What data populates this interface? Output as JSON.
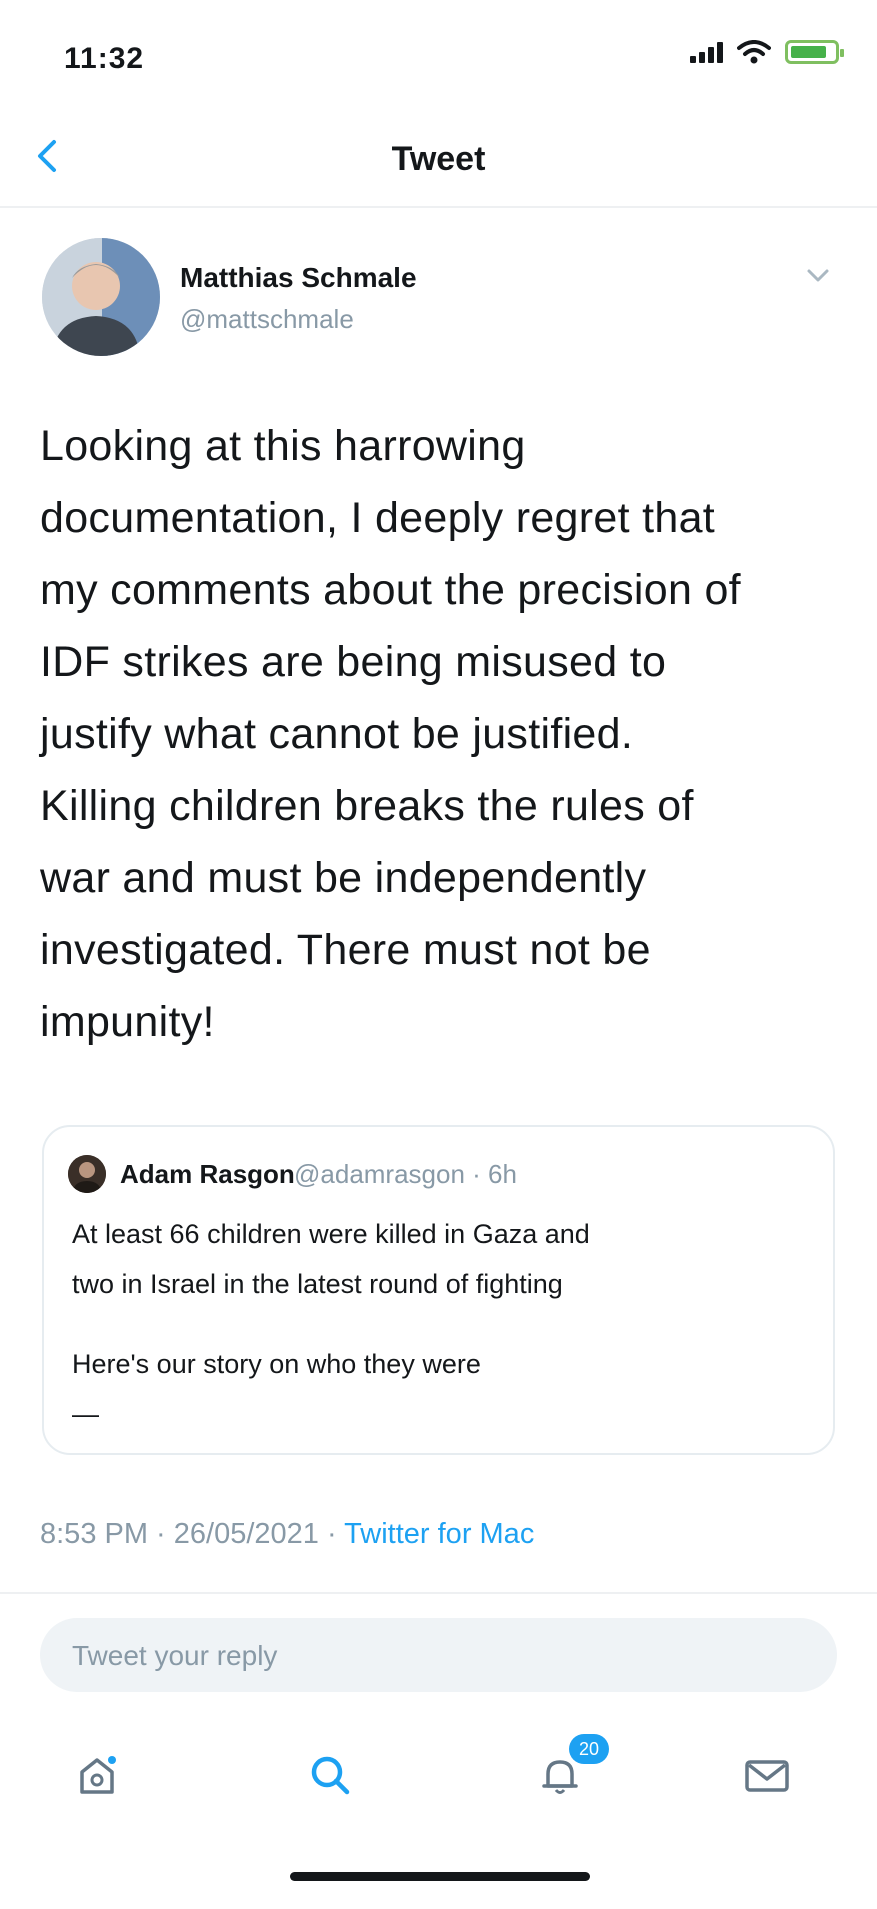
{
  "status_bar": {
    "time": "11:32"
  },
  "nav": {
    "title": "Tweet"
  },
  "tweet": {
    "author_name": "Matthias Schmale",
    "author_handle": "@mattschmale",
    "text_lines": [
      "Looking at this harrowing",
      "documentation, I deeply regret that",
      "my comments about the precision of",
      "IDF strikes are being misused to",
      "justify what cannot be justified.",
      "Killing children breaks the rules of",
      "war and must be independently",
      "investigated. There must not be",
      "impunity!"
    ],
    "quoted": {
      "author_name": "Adam Rasgon",
      "author_handle_time": "@adamrasgon · 6h",
      "line1": "At least 66 children were killed in Gaza and",
      "line2": "two in Israel in the latest round of fighting",
      "line3": "Here's our story on who they were",
      "line4": "—"
    },
    "timestamp": "8:53 PM · 26/05/2021 · ",
    "client": "Twitter for Mac"
  },
  "reply": {
    "placeholder": "Tweet your reply"
  },
  "tabs": {
    "notifications_badge": "20"
  },
  "colors": {
    "accent": "#1da1f2",
    "secondary_text": "#8899a6",
    "reply_bg": "#eff3f6"
  },
  "icons": [
    "back-chevron-icon",
    "chevron-down-icon",
    "home-icon",
    "search-icon",
    "notifications-icon",
    "messages-icon"
  ]
}
